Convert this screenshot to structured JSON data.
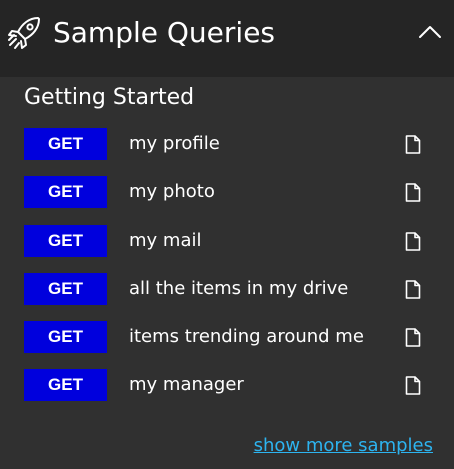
{
  "header": {
    "title": "Sample Queries",
    "icon": "rocket-icon",
    "collapse_icon": "chevron-up-icon"
  },
  "section": {
    "title": "Getting Started"
  },
  "queries": [
    {
      "method": "GET",
      "label": "my profile",
      "icon": "document-icon"
    },
    {
      "method": "GET",
      "label": "my photo",
      "icon": "document-icon"
    },
    {
      "method": "GET",
      "label": "my mail",
      "icon": "document-icon"
    },
    {
      "method": "GET",
      "label": "all the items in my drive",
      "icon": "document-icon"
    },
    {
      "method": "GET",
      "label": "items trending around me",
      "icon": "document-icon"
    },
    {
      "method": "GET",
      "label": "my manager",
      "icon": "document-icon"
    }
  ],
  "footer": {
    "more_link": "show more samples"
  },
  "colors": {
    "background": "#303030",
    "header_background": "#252525",
    "method_badge": "#0000dd",
    "link": "#2db4f0",
    "text": "#ffffff"
  }
}
